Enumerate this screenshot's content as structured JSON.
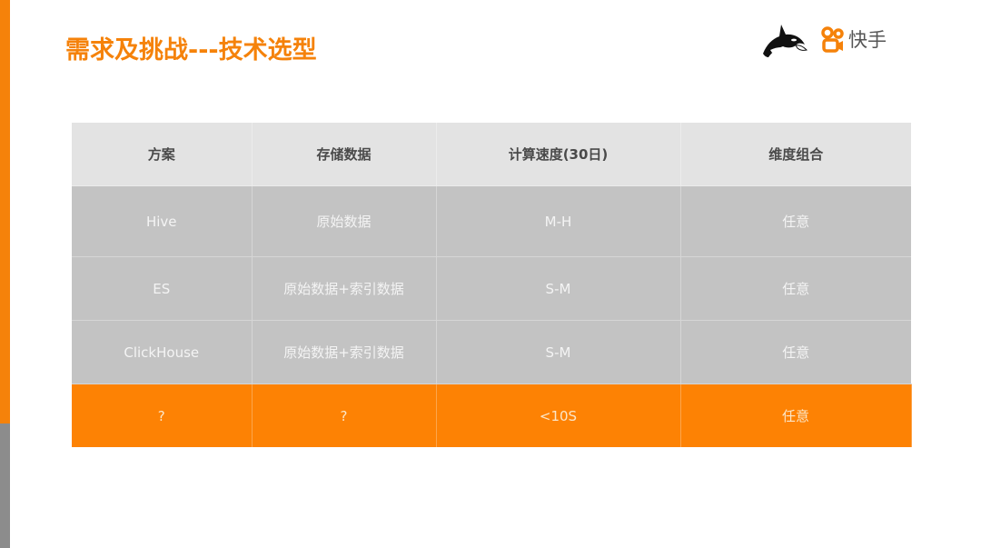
{
  "slide": {
    "title": "需求及挑战---技术选型",
    "brand": {
      "name": "快手",
      "accent_color": "#f5820a",
      "icons": [
        "orca-icon",
        "kuaishou-logo-icon"
      ]
    }
  },
  "table": {
    "headers": [
      "方案",
      "存储数据",
      "计算速度(30日)",
      "维度组合"
    ],
    "rows": [
      {
        "cells": [
          "Hive",
          "原始数据",
          "M-H",
          "任意"
        ],
        "highlight": false
      },
      {
        "cells": [
          "ES",
          "原始数据+索引数据",
          "S-M",
          "任意"
        ],
        "highlight": false
      },
      {
        "cells": [
          "ClickHouse",
          "原始数据+索引数据",
          "S-M",
          "任意"
        ],
        "highlight": false
      },
      {
        "cells": [
          "?",
          "?",
          "<10S",
          "任意"
        ],
        "highlight": true
      }
    ],
    "colors": {
      "header_bg": "#e3e3e3",
      "row_bg": "#c3c3c3",
      "highlight_bg": "#fd8204"
    }
  }
}
